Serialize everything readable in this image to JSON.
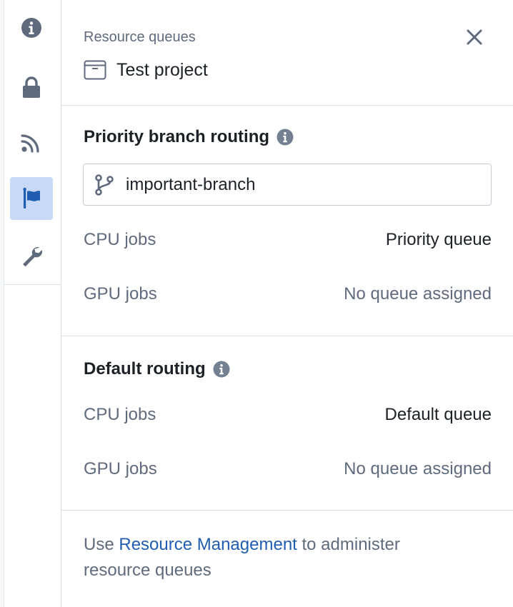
{
  "sidebar": {
    "items": [
      {
        "icon": "info-icon",
        "active": false
      },
      {
        "icon": "lock-icon",
        "active": false
      },
      {
        "icon": "rss-feed-icon",
        "active": false
      },
      {
        "icon": "flag-icon",
        "active": true
      },
      {
        "icon": "wrench-icon",
        "active": false
      }
    ],
    "active_color": "#c7d9f4",
    "icon_color": "#5f6b7c",
    "active_icon_color": "#215db0"
  },
  "header": {
    "subtitle": "Resource queues",
    "project_icon": "archive-box-icon",
    "title": "Test project",
    "close_icon": "close-icon"
  },
  "priority_routing": {
    "title": "Priority branch routing",
    "branch_icon": "git-branch-icon",
    "branch": "important-branch",
    "rows": [
      {
        "label": "CPU jobs",
        "value": "Priority queue"
      },
      {
        "label": "GPU jobs",
        "value": "No queue assigned"
      }
    ]
  },
  "default_routing": {
    "title": "Default routing",
    "rows": [
      {
        "label": "CPU jobs",
        "value": "Default queue"
      },
      {
        "label": "GPU jobs",
        "value": "No queue assigned"
      }
    ]
  },
  "footer": {
    "prefix": "Use ",
    "link": "Resource Management",
    "suffix": " to administer resource queues"
  },
  "colors": {
    "link": "#215db0",
    "muted_text": "#5f6b7c",
    "text": "#1c2127",
    "border": "#dce0e5"
  }
}
